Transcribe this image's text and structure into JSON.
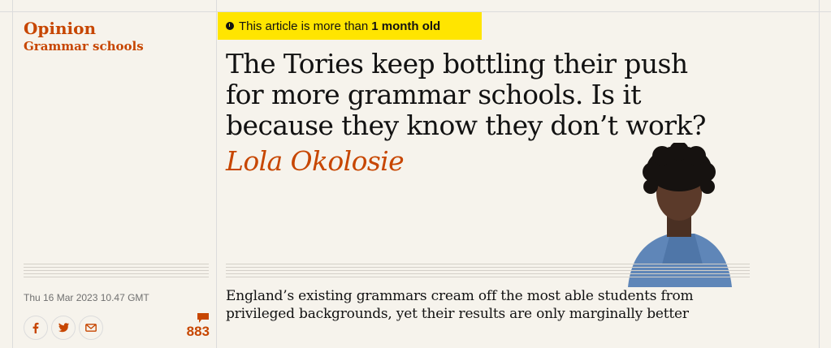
{
  "kicker": {
    "section": "Opinion",
    "series": "Grammar schools"
  },
  "age_warning": {
    "prefix": "This article is more than",
    "emphasis": "1 month old",
    "icon": "clock-icon"
  },
  "article": {
    "headline": "The Tories keep bottling their push for more grammar schools. Is it because they know they don’t work?",
    "byline": "Lola Okolosie",
    "standfirst": "England’s existing grammars cream off the most able students from privileged backgrounds, yet their results are only marginally better",
    "dateline": "Thu 16 Mar 2023 10.47 GMT"
  },
  "share": {
    "buttons": [
      {
        "name": "facebook",
        "icon": "facebook-icon"
      },
      {
        "name": "twitter",
        "icon": "twitter-icon"
      },
      {
        "name": "email",
        "icon": "envelope-icon"
      }
    ]
  },
  "comments": {
    "count": "883",
    "icon": "comment-bubble-icon"
  },
  "colors": {
    "accent": "#c74600",
    "badge": "#ffe500",
    "background": "#f6f3ec"
  }
}
